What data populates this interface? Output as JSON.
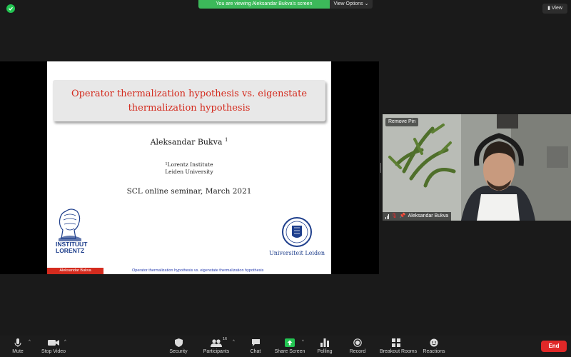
{
  "top": {
    "viewing_banner": "You are viewing Aleksandar Bukva's screen",
    "view_options": "View Options ⌄",
    "view_button": "View"
  },
  "slide": {
    "title_line1": "Operator thermalization hypothesis vs. eigenstate",
    "title_line2": "thermalization hypothesis",
    "author": "Aleksandar Bukva",
    "author_sup": "1",
    "affil_line1": "¹Lorentz Institute",
    "affil_line2": "Leiden University",
    "seminar": "SCL online seminar, March 2021",
    "logo_left_line1": "INSTITUUT",
    "logo_left_line2": "LORENTZ",
    "logo_right_text": "Universiteit Leiden",
    "footer_author": "Aleksandar Bukva",
    "footer_title": "Operator thermalization hypothesis vs. eigenstate thermalization hypothesis"
  },
  "video": {
    "remove_pin": "Remove Pin",
    "name": "Aleksandar Bukva"
  },
  "toolbar": {
    "mute": "Mute",
    "stop_video": "Stop Video",
    "security": "Security",
    "participants": "Participants",
    "participants_count": "16",
    "chat": "Chat",
    "share_screen": "Share Screen",
    "polling": "Polling",
    "record": "Record",
    "breakout_rooms": "Breakout Rooms",
    "reactions": "Reactions",
    "end": "End"
  },
  "colors": {
    "accent_green": "#3cb95a",
    "slide_red": "#d42b1e",
    "leiden_blue": "#1f3f8c",
    "end_red": "#e02828"
  }
}
